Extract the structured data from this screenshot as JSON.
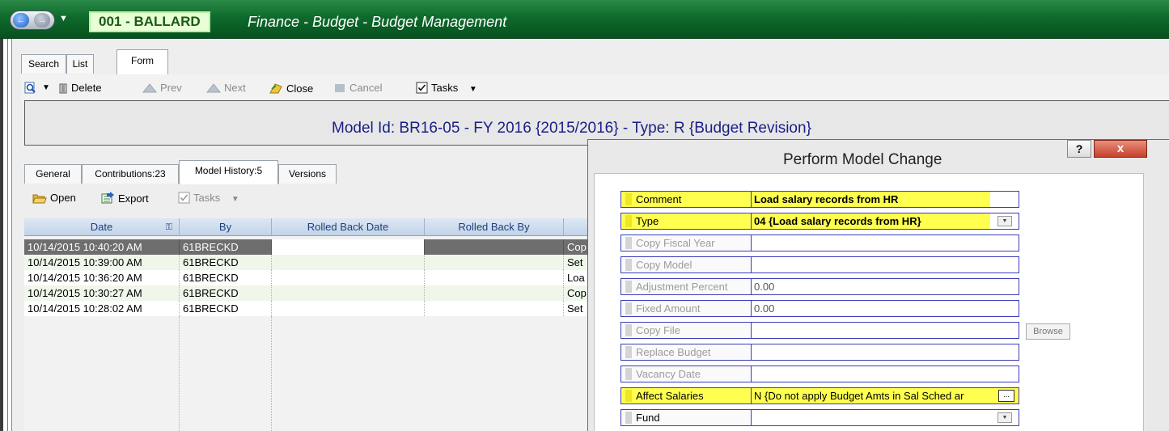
{
  "titlebar": {
    "org": "001 - BALLARD",
    "title": "Finance - Budget - Budget Management"
  },
  "view_tabs": [
    "Search",
    "List",
    "Form"
  ],
  "toolbar": {
    "delete": "Delete",
    "prev": "Prev",
    "next": "Next",
    "close": "Close",
    "cancel": "Cancel",
    "tasks": "Tasks"
  },
  "model_title": "Model Id: BR16-05 - FY 2016 {2015/2016} - Type: R {Budget Revision}",
  "sub_tabs": [
    "General",
    "Contributions:23",
    "Model History:5",
    "Versions"
  ],
  "sub_toolbar": {
    "open": "Open",
    "export": "Export",
    "tasks": "Tasks"
  },
  "grid": {
    "columns": [
      "Date",
      "By",
      "Rolled Back Date",
      "Rolled Back By",
      ""
    ],
    "rows": [
      {
        "date": "10/14/2015 10:40:20 AM",
        "by": "61BRECKD",
        "rb_date": "",
        "rb_by": "",
        "desc": "Cop"
      },
      {
        "date": "10/14/2015 10:39:00 AM",
        "by": "61BRECKD",
        "rb_date": "",
        "rb_by": "",
        "desc": "Set"
      },
      {
        "date": "10/14/2015 10:36:20 AM",
        "by": "61BRECKD",
        "rb_date": "",
        "rb_by": "",
        "desc": "Loa"
      },
      {
        "date": "10/14/2015 10:30:27 AM",
        "by": "61BRECKD",
        "rb_date": "",
        "rb_by": "",
        "desc": "Cop"
      },
      {
        "date": "10/14/2015 10:28:02 AM",
        "by": "61BRECKD",
        "rb_date": "",
        "rb_by": "",
        "desc": "Set"
      }
    ]
  },
  "dialog": {
    "title": "Perform Model Change",
    "help": "?",
    "close": "x",
    "browse": "Browse",
    "fields": [
      {
        "label": "Comment",
        "value": "Load salary records from HR"
      },
      {
        "label": "Type",
        "value": "04 {Load salary records from HR}"
      },
      {
        "label": "Copy Fiscal Year",
        "value": ""
      },
      {
        "label": "Copy Model",
        "value": ""
      },
      {
        "label": "Adjustment Percent",
        "value": "0.00"
      },
      {
        "label": "Fixed Amount",
        "value": "0.00"
      },
      {
        "label": "Copy File",
        "value": ""
      },
      {
        "label": "Replace Budget",
        "value": ""
      },
      {
        "label": "Vacancy Date",
        "value": ""
      },
      {
        "label": "Affect Salaries",
        "value": "N {Do not apply Budget Amts in Sal Sched ar"
      },
      {
        "label": "Fund",
        "value": ""
      }
    ]
  },
  "colors": {
    "title_green": "#0e6a2c",
    "highlight_yellow": "#ffff4f",
    "field_border": "#3d3db8",
    "header_blue_text": "#1a1f87"
  }
}
